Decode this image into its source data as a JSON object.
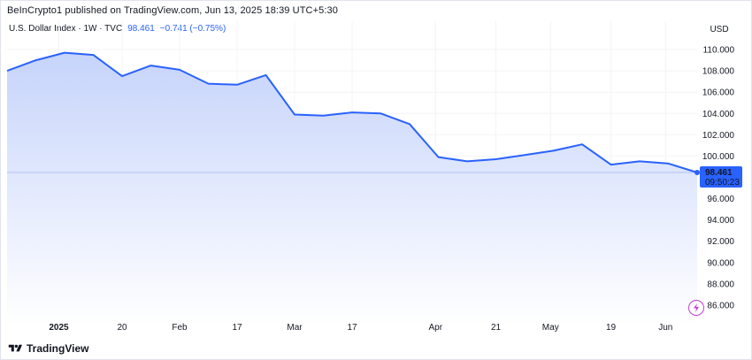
{
  "header": {
    "published_line": "BeInCrypto1 published on TradingView.com, Jun 13, 2025 18:39 UTC+5:30"
  },
  "legend": {
    "symbol": "U.S. Dollar Index · 1W · TVC",
    "price": "98.461",
    "change": "−0.741 (−0.75%)"
  },
  "price_scale": {
    "currency": "USD"
  },
  "last_price": {
    "value": "98.461",
    "countdown": "09:50:23"
  },
  "footer": {
    "brand": "TradingView"
  },
  "colors": {
    "line": "#2962ff",
    "area_top": "#c6d4fb",
    "area_bottom": "#ffffff",
    "price_label_bg": "#2962ff",
    "grid": "#f3f4f7"
  },
  "icons": {
    "brand_logo": "tradingview-logo-icon",
    "lightning": "lightning-icon"
  },
  "chart_data": {
    "type": "area",
    "title": "U.S. Dollar Index · 1W · TVC",
    "ylim": [
      85.0,
      111.0
    ],
    "y_ticks": [
      86.0,
      88.0,
      90.0,
      92.0,
      94.0,
      96.0,
      98.0,
      100.0,
      102.0,
      104.0,
      106.0,
      108.0,
      110.0
    ],
    "y_tick_labels": [
      "86.000",
      "88.000",
      "90.000",
      "92.000",
      "94.000",
      "96.000",
      "98.000",
      "100.000",
      "102.000",
      "104.000",
      "106.000",
      "108.000",
      "110.000"
    ],
    "x_tick_labels": [
      {
        "label": "2025",
        "bold": true,
        "index": 1.8
      },
      {
        "label": "20",
        "index": 4.0
      },
      {
        "label": "Feb",
        "index": 6.0
      },
      {
        "label": "17",
        "index": 8.0
      },
      {
        "label": "Mar",
        "index": 10.0
      },
      {
        "label": "17",
        "index": 12.0
      },
      {
        "label": "Apr",
        "index": 14.9
      },
      {
        "label": "21",
        "index": 17.0
      },
      {
        "label": "May",
        "index": 18.9
      },
      {
        "label": "19",
        "index": 21.0
      },
      {
        "label": "Jun",
        "index": 22.9
      }
    ],
    "series": [
      {
        "values": [
          108.0,
          109.0,
          109.7,
          109.5,
          107.5,
          108.5,
          108.1,
          106.8,
          106.7,
          107.6,
          103.9,
          103.8,
          104.1,
          104.0,
          103.0,
          99.9,
          99.5,
          99.7,
          100.1,
          100.5,
          101.1,
          99.2,
          99.5,
          99.3,
          98.461
        ]
      }
    ],
    "last_value": 98.461,
    "grid": true
  }
}
